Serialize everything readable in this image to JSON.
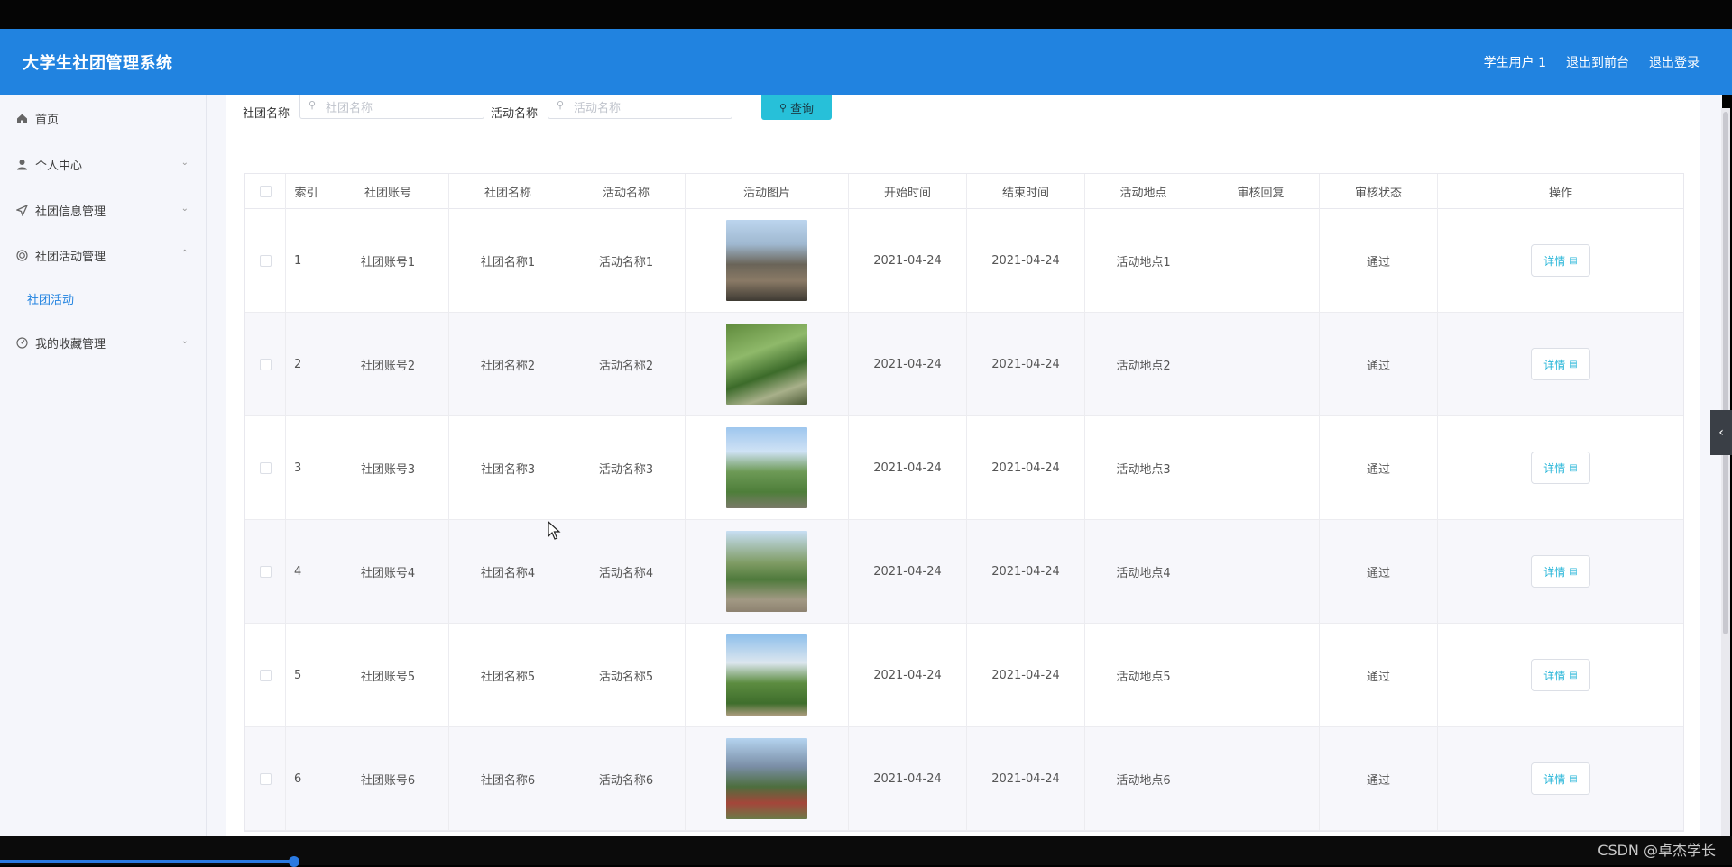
{
  "header": {
    "app_title": "大学生社团管理系统",
    "user": "学生用户 1",
    "back_to_front": "退出到前台",
    "logout": "退出登录"
  },
  "sidebar": {
    "items": [
      {
        "label": "首页",
        "icon": "home-icon"
      },
      {
        "label": "个人中心",
        "icon": "user-icon",
        "chevron": "down"
      },
      {
        "label": "社团信息管理",
        "icon": "send-icon",
        "chevron": "down"
      },
      {
        "label": "社团活动管理",
        "icon": "target-icon",
        "chevron": "up"
      },
      {
        "label": "我的收藏管理",
        "icon": "dashboard-icon",
        "chevron": "down"
      }
    ],
    "active_sub": "社团活动"
  },
  "search": {
    "club_label": "社团名称",
    "club_placeholder": "社团名称",
    "activity_label": "活动名称",
    "activity_placeholder": "活动名称",
    "button": "查询"
  },
  "table": {
    "columns": [
      "索引",
      "社团账号",
      "社团名称",
      "活动名称",
      "活动图片",
      "开始时间",
      "结束时间",
      "活动地点",
      "审核回复",
      "审核状态",
      "操作"
    ],
    "rows": [
      {
        "index": "1",
        "account": "社团账号1",
        "club": "社团名称1",
        "activity": "活动名称1",
        "start": "2021-04-24",
        "end": "2021-04-24",
        "place": "活动地点1",
        "reply": "",
        "status": "通过",
        "action": "详情"
      },
      {
        "index": "2",
        "account": "社团账号2",
        "club": "社团名称2",
        "activity": "活动名称2",
        "start": "2021-04-24",
        "end": "2021-04-24",
        "place": "活动地点2",
        "reply": "",
        "status": "通过",
        "action": "详情"
      },
      {
        "index": "3",
        "account": "社团账号3",
        "club": "社团名称3",
        "activity": "活动名称3",
        "start": "2021-04-24",
        "end": "2021-04-24",
        "place": "活动地点3",
        "reply": "",
        "status": "通过",
        "action": "详情"
      },
      {
        "index": "4",
        "account": "社团账号4",
        "club": "社团名称4",
        "activity": "活动名称4",
        "start": "2021-04-24",
        "end": "2021-04-24",
        "place": "活动地点4",
        "reply": "",
        "status": "通过",
        "action": "详情"
      },
      {
        "index": "5",
        "account": "社团账号5",
        "club": "社团名称5",
        "activity": "活动名称5",
        "start": "2021-04-24",
        "end": "2021-04-24",
        "place": "活动地点5",
        "reply": "",
        "status": "通过",
        "action": "详情"
      },
      {
        "index": "6",
        "account": "社团账号6",
        "club": "社团名称6",
        "activity": "活动名称6",
        "start": "2021-04-24",
        "end": "2021-04-24",
        "place": "活动地点6",
        "reply": "",
        "status": "通过",
        "action": "详情"
      }
    ]
  },
  "colors": {
    "header": "#2183e0",
    "accent": "#27c0d9",
    "link": "#26b5d8"
  },
  "watermark": "CSDN @卓杰学长"
}
